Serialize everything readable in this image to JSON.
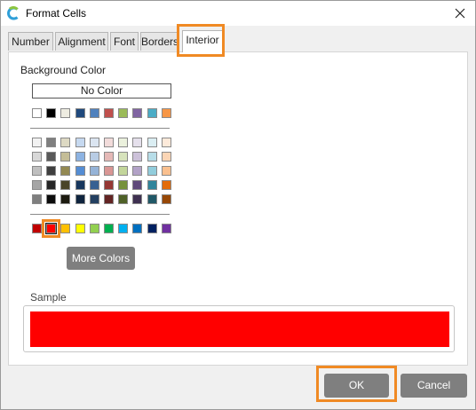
{
  "window": {
    "title": "Format Cells",
    "app_icon": "app-logo-icon",
    "close_icon": "close-icon"
  },
  "tabs": [
    {
      "label": "Number"
    },
    {
      "label": "Alignment"
    },
    {
      "label": "Font"
    },
    {
      "label": "Borders"
    },
    {
      "label": "Interior",
      "active": true
    }
  ],
  "interior": {
    "section_label": "Background Color",
    "no_color_label": "No Color",
    "more_colors_label": "More Colors",
    "sample_label": "Sample",
    "sample_color": "#ff0000",
    "selected_color": "#ff0000",
    "palette": {
      "theme_row": [
        "#ffffff",
        "#000000",
        "#eeece1",
        "#1f497d",
        "#4f81bd",
        "#c0504d",
        "#9bbb59",
        "#8064a2",
        "#4bacc6",
        "#f79646"
      ],
      "tints": [
        [
          "#f2f2f2",
          "#7f7f7f",
          "#ddd9c3",
          "#c6d9f0",
          "#dbe5f1",
          "#f2dcdb",
          "#ebf1dd",
          "#e5e0ec",
          "#dbeef3",
          "#fdeada"
        ],
        [
          "#d8d8d8",
          "#595959",
          "#c4bd97",
          "#8db3e2",
          "#b8cce4",
          "#e5b9b7",
          "#d7e3bc",
          "#ccc1d9",
          "#b7dde8",
          "#fbd5b5"
        ],
        [
          "#bfbfbf",
          "#3f3f3f",
          "#938953",
          "#548dd4",
          "#95b3d7",
          "#d99694",
          "#c3d69b",
          "#b2a2c7",
          "#92cddc",
          "#fac08f"
        ],
        [
          "#a5a5a5",
          "#262626",
          "#494429",
          "#17365d",
          "#366092",
          "#953734",
          "#76923c",
          "#5f497a",
          "#31859b",
          "#e36c09"
        ],
        [
          "#7f7f7f",
          "#0c0c0c",
          "#1d1b10",
          "#0f243e",
          "#244061",
          "#632423",
          "#4f6128",
          "#3f3151",
          "#205867",
          "#974806"
        ]
      ],
      "standard_row": [
        "#c00000",
        "#ff0000",
        "#ffc000",
        "#ffff00",
        "#92d050",
        "#00b050",
        "#00b0f0",
        "#0070c0",
        "#002060",
        "#7030a0"
      ]
    }
  },
  "footer": {
    "ok_label": "OK",
    "cancel_label": "Cancel"
  },
  "colors": {
    "highlight": "#f08a24",
    "button_bg": "#7f7f7f"
  }
}
